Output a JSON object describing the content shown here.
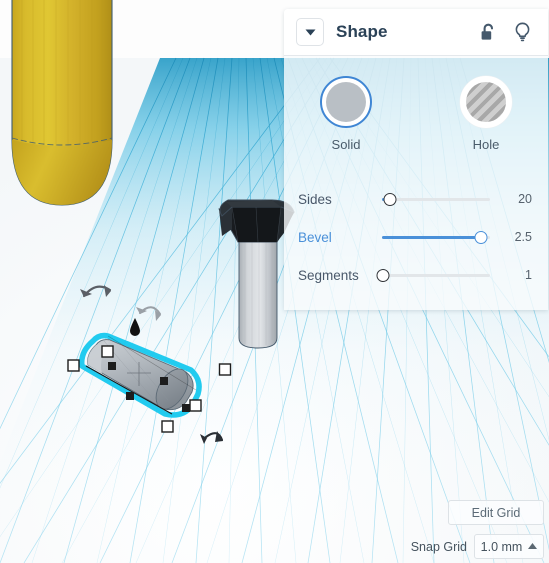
{
  "panel": {
    "title": "Shape",
    "collapse_icon": "chevron-down-icon",
    "lock_icon": "unlock-icon",
    "light_icon": "lightbulb-icon",
    "modes": [
      {
        "label": "Solid",
        "icon": "solid-circle-swatch",
        "selected": true
      },
      {
        "label": "Hole",
        "icon": "hole-hatched-swatch",
        "selected": false
      }
    ],
    "sliders": [
      {
        "label": "Sides",
        "value": "20",
        "percent": 7,
        "active": false,
        "fill_percent": 4
      },
      {
        "label": "Bevel",
        "value": "2.5",
        "percent": 92,
        "active": true,
        "fill_percent": 92
      },
      {
        "label": "Segments",
        "value": "1",
        "percent": 0,
        "active": false,
        "fill_percent": 0
      }
    ]
  },
  "viewport": {
    "edit_grid_label": "Edit Grid",
    "snap_grid_label": "Snap Grid",
    "snap_grid_value": "1.0 mm",
    "snap_caret_icon": "caret-up-icon",
    "objects": [
      {
        "name": "yellow-rounded-cylinder",
        "color": "#d4b429"
      },
      {
        "name": "black-faceted-cone",
        "color": "#1f2226"
      },
      {
        "name": "gray-cylinder-stem",
        "color": "#c8ccd0"
      },
      {
        "name": "selected-gray-capsule",
        "color": "#b4bac0",
        "highlight": "#16c8ee",
        "selected": true
      }
    ],
    "handles": {
      "rotate_icon": "rotate-arrow-icon",
      "height_icon": "height-teardrop-handle",
      "scale_icon": "scale-square-handle"
    },
    "grid_color": "#4fc3e8",
    "grid_far_color": "#2196c4"
  }
}
